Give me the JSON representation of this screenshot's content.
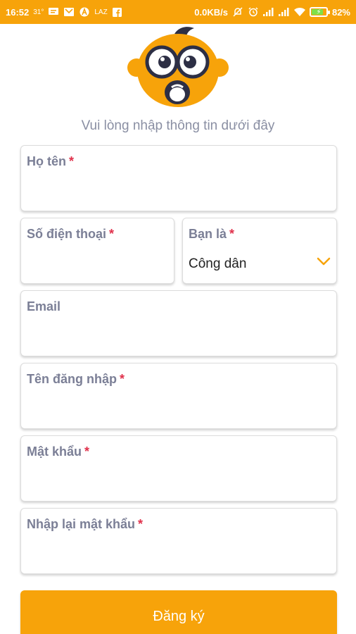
{
  "status_bar": {
    "time": "16:52",
    "temp": "31°",
    "carrier_tag": "LAZ",
    "net_speed": "0.0KB/s",
    "battery": "82%",
    "battery_level": 0.82
  },
  "subtitle": "Vui lòng nhập thông tin dưới đây",
  "form": {
    "full_name": {
      "label": "Họ tên",
      "required": "*"
    },
    "phone": {
      "label": "Số điện thoại",
      "required": "*"
    },
    "role": {
      "label": "Bạn là",
      "required": "*",
      "value": "Công dân"
    },
    "email": {
      "label": "Email"
    },
    "username": {
      "label": "Tên đăng nhập",
      "required": "*"
    },
    "password": {
      "label": "Mật khẩu",
      "required": "*"
    },
    "password_confirm": {
      "label": "Nhập lại mật khẩu",
      "required": "*"
    },
    "submit_label": "Đăng ký"
  },
  "colors": {
    "brand": "#f7a30a",
    "label": "#7b7f96",
    "required": "#e0314b"
  }
}
